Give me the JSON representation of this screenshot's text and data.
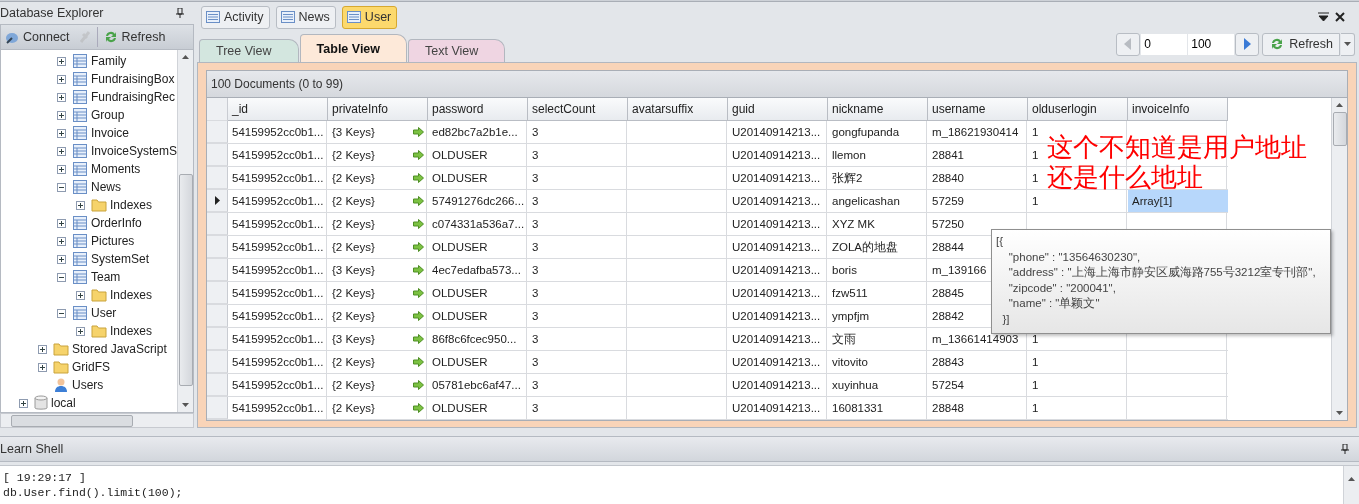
{
  "explorer": {
    "title": "Database Explorer",
    "toolbar": [
      {
        "kind": "connect",
        "label": "Connect"
      },
      {
        "kind": "disconnect",
        "disabled": true
      },
      {
        "kind": "refresh",
        "label": "Refresh"
      }
    ],
    "tree": [
      {
        "children": [
          {
            "children": [
              {
                "label": "Family",
                "kind": "collection",
                "expanded": false
              },
              {
                "label": "FundraisingBox",
                "kind": "collection",
                "expanded": false
              },
              {
                "label": "FundraisingRec",
                "kind": "collection",
                "expanded": false
              },
              {
                "label": "Group",
                "kind": "collection",
                "expanded": false
              },
              {
                "label": "Invoice",
                "kind": "collection",
                "expanded": false
              },
              {
                "label": "InvoiceSystemS",
                "kind": "collection",
                "expanded": false
              },
              {
                "label": "Moments",
                "kind": "collection",
                "expanded": false
              },
              {
                "label": "News",
                "kind": "collection",
                "expanded": true,
                "children": [
                  {
                    "label": "Indexes",
                    "kind": "folder",
                    "expanded": false
                  }
                ]
              },
              {
                "label": "OrderInfo",
                "kind": "collection",
                "expanded": false
              },
              {
                "label": "Pictures",
                "kind": "collection",
                "expanded": false
              },
              {
                "label": "SystemSet",
                "kind": "collection",
                "expanded": false
              },
              {
                "label": "Team",
                "kind": "collection",
                "expanded": true,
                "children": [
                  {
                    "label": "Indexes",
                    "kind": "folder",
                    "expanded": false
                  }
                ]
              },
              {
                "label": "User",
                "kind": "collection",
                "expanded": true,
                "children": [
                  {
                    "label": "Indexes",
                    "kind": "folder",
                    "expanded": false
                  }
                ]
              }
            ]
          },
          {
            "label": "Stored JavaScript",
            "kind": "folder",
            "expanded": false
          },
          {
            "label": "GridFS",
            "kind": "folder",
            "expanded": false
          },
          {
            "label": "Users",
            "kind": "user"
          }
        ]
      },
      {
        "label": "local",
        "kind": "database",
        "expanded": false
      }
    ]
  },
  "doc_tabs": [
    {
      "label": "Activity",
      "selected": false
    },
    {
      "label": "News",
      "selected": false
    },
    {
      "label": "User",
      "selected": true
    }
  ],
  "view_tabs": [
    {
      "label": "Tree View",
      "selected": false,
      "color": "#d3e6df"
    },
    {
      "label": "Table View",
      "selected": true,
      "color": "#fde9d9"
    },
    {
      "label": "Text View",
      "selected": false,
      "color": "#efd5e2"
    }
  ],
  "pager": {
    "skip": "0",
    "limit": "100",
    "refresh": "Refresh"
  },
  "results": {
    "summary": "100 Documents (0 to 99)",
    "columns": [
      "_id",
      "privateInfo",
      "password",
      "selectCount",
      "avatarsuffix",
      "guid",
      "nickname",
      "username",
      "olduserlogin",
      "invoiceInfo"
    ],
    "rows": [
      {
        "current": false,
        "cells": [
          "54159952cc0b1...",
          "{3 Keys}",
          "ed82bc7a2b1e...",
          "3",
          null,
          "U20140914213...",
          "gongfupanda",
          "m_18621930414",
          "1",
          null
        ]
      },
      {
        "current": false,
        "cells": [
          "54159952cc0b1...",
          "{2 Keys}",
          "OLDUSER",
          "3",
          null,
          "U20140914213...",
          "llemon",
          "28841",
          "1",
          null
        ]
      },
      {
        "current": false,
        "cells": [
          "54159952cc0b1...",
          "{2 Keys}",
          "OLDUSER",
          "3",
          null,
          "U20140914213...",
          "张辉2",
          "28840",
          "1",
          null
        ]
      },
      {
        "current": true,
        "cells": [
          "54159952cc0b1...",
          "{2 Keys}",
          "57491276dc266...",
          "3",
          null,
          "U20140914213...",
          "angelicashan",
          "57259",
          "1",
          "Array[1]"
        ]
      },
      {
        "current": false,
        "cells": [
          "54159952cc0b1...",
          "{2 Keys}",
          "c074331a536a7...",
          "3",
          null,
          "U20140914213...",
          "XYZ MK",
          "57250",
          null,
          null
        ]
      },
      {
        "current": false,
        "cells": [
          "54159952cc0b1...",
          "{2 Keys}",
          "OLDUSER",
          "3",
          null,
          "U20140914213...",
          "ZOLA的地盘",
          "28844",
          null,
          null
        ]
      },
      {
        "current": false,
        "cells": [
          "54159952cc0b1...",
          "{3 Keys}",
          "4ec7edafba573...",
          "3",
          null,
          "U20140914213...",
          "boris",
          "m_139166",
          null,
          null
        ]
      },
      {
        "current": false,
        "cells": [
          "54159952cc0b1...",
          "{2 Keys}",
          "OLDUSER",
          "3",
          null,
          "U20140914213...",
          "fzw511",
          "28845",
          null,
          null
        ]
      },
      {
        "current": false,
        "cells": [
          "54159952cc0b1...",
          "{2 Keys}",
          "OLDUSER",
          "3",
          null,
          "U20140914213...",
          "ympfjm",
          "28842",
          null,
          null
        ]
      },
      {
        "current": false,
        "cells": [
          "54159952cc0b1...",
          "{3 Keys}",
          "86f8c6fcec950...",
          "3",
          null,
          "U20140914213...",
          "文雨",
          "m_13661414903",
          "1",
          null
        ]
      },
      {
        "current": false,
        "cells": [
          "54159952cc0b1...",
          "{2 Keys}",
          "OLDUSER",
          "3",
          null,
          "U20140914213...",
          "vitovito",
          "28843",
          "1",
          null
        ]
      },
      {
        "current": false,
        "cells": [
          "54159952cc0b1...",
          "{2 Keys}",
          "05781ebc6af47...",
          "3",
          null,
          "U20140914213...",
          "xuyinhua",
          "57254",
          "1",
          null
        ]
      },
      {
        "current": false,
        "cells": [
          "54159952cc0b1...",
          "{2 Keys}",
          "OLDUSER",
          "3",
          null,
          "U20140914213...",
          "16081331",
          "28848",
          "1",
          null
        ]
      }
    ]
  },
  "tooltip": {
    "lines": [
      "[{",
      "    \"phone\" : \"13564630230\",",
      "    \"address\" : \"上海上海市静安区威海路755号3212室专刊部\",",
      "    \"zipcode\" : \"200041\",",
      "    \"name\" : \"单颖文\"",
      "  }]"
    ]
  },
  "annotation": {
    "lines": [
      "这个不知道是用户地址",
      "还是什么地址"
    ]
  },
  "shell": {
    "title": "Learn Shell",
    "lines": [
      "[ 19:29:17 ]",
      "db.User.find().limit(100);"
    ]
  }
}
